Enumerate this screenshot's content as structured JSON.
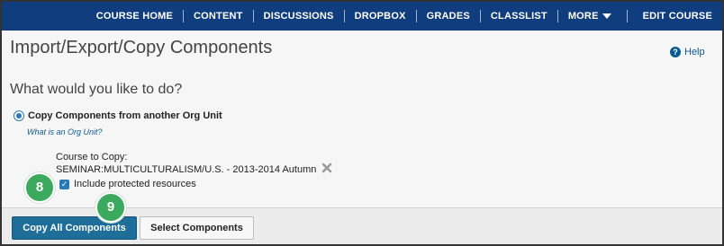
{
  "nav": {
    "items": [
      "COURSE HOME",
      "CONTENT",
      "DISCUSSIONS",
      "DROPBOX",
      "GRADES",
      "CLASSLIST",
      "MORE"
    ],
    "edit_course": "EDIT COURSE"
  },
  "page": {
    "title": "Import/Export/Copy Components",
    "help": "Help",
    "question": "What would you like to do?"
  },
  "option": {
    "label": "Copy Components from another Org Unit",
    "link": "What is an Org Unit?",
    "course_label": "Course to Copy:",
    "course_value": "SEMINAR:MULTICULTURALISM/U.S. - 2013-2014 Autumn",
    "checkbox_label": "Include protected resources",
    "checkbox_checked": true
  },
  "badges": {
    "eight": "8",
    "nine": "9",
    "color": "#3caa5e"
  },
  "buttons": {
    "copy_all": "Copy All Components",
    "select": "Select Components"
  },
  "colors": {
    "nav_bg": "#0f3d7d",
    "accent": "#1f6e99"
  }
}
